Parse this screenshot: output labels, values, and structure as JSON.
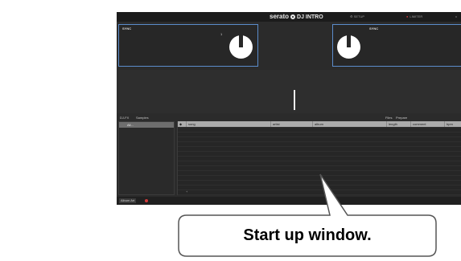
{
  "titlebar": {
    "brand": "serato",
    "product": "DJ INTRO",
    "setup_label": "SETUP",
    "limiter_label": "LIMITER",
    "close_label": "x"
  },
  "decks": {
    "left": {
      "sync_label": "SYNC",
      "deck_number": "1"
    },
    "right": {
      "sync_label": "SYNC"
    }
  },
  "library": {
    "left_tabs": {
      "fx": "DJ-FX",
      "samples": "Samples"
    },
    "right_tabs": {
      "files": "Files",
      "prepare": "Prepare"
    },
    "crate_all": "All...",
    "columns": [
      "song",
      "artist",
      "album",
      "length",
      "comment",
      "bpm"
    ],
    "foot_mark": "+"
  },
  "bottom_bar": {
    "album_art_label": "Album Art"
  },
  "callout": {
    "text": "Start up window."
  },
  "colors": {
    "app_background": "#2b2b2b",
    "deck_border": "#5b8ccb",
    "limiter_dot": "#d23a3a",
    "header_background": "#ababab"
  }
}
